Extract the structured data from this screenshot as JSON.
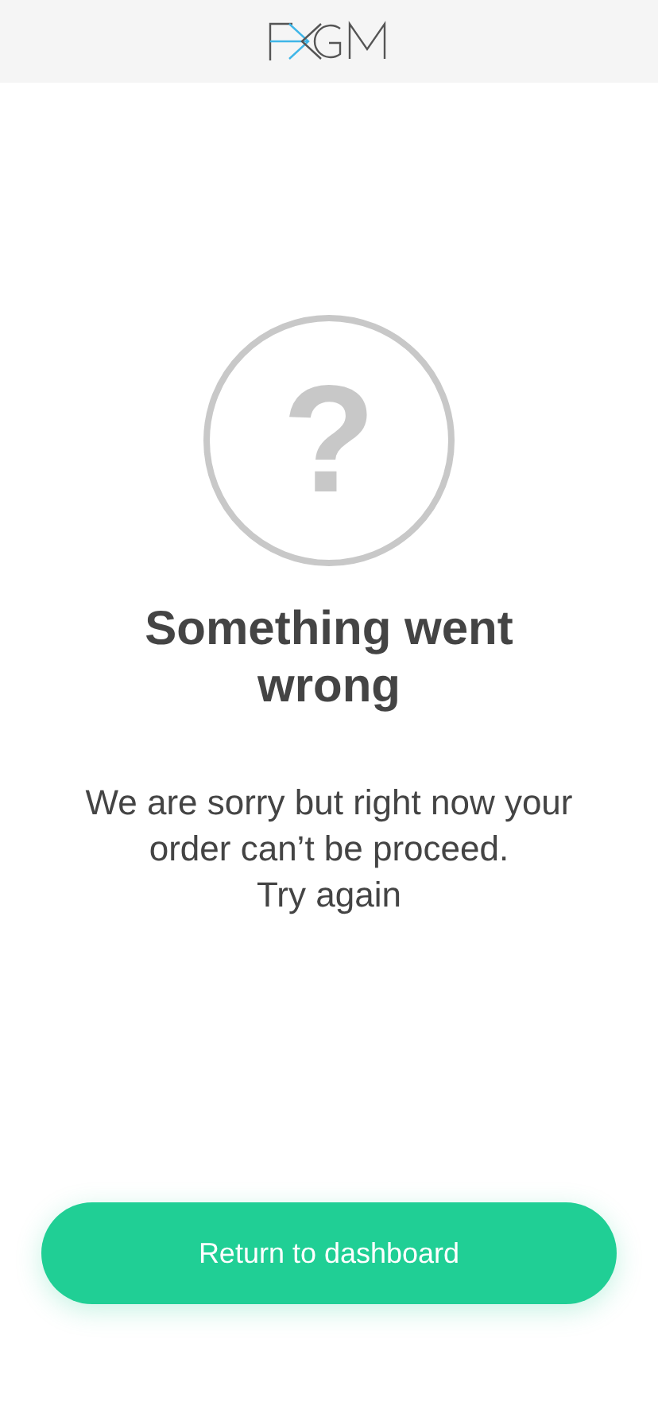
{
  "error": {
    "title": "Something went wrong",
    "message": "We are sorry but right now your order can’t be proceed.",
    "hint": "Try again",
    "icon": "?"
  },
  "button": {
    "label": "Return to dashboard"
  }
}
